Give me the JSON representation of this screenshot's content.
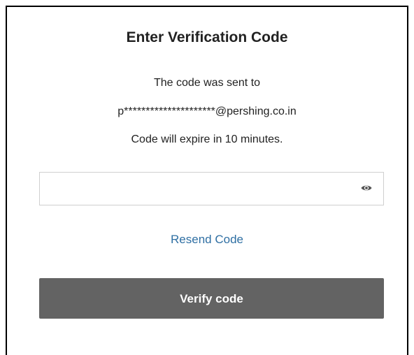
{
  "dialog": {
    "title": "Enter Verification Code",
    "sent_to_text": "The code was sent to",
    "email": "p*********************@pershing.co.in",
    "expiry_text": "Code will expire in 10 minutes."
  },
  "code_field": {
    "value": "",
    "placeholder": "",
    "toggle_icon": "eye-icon"
  },
  "resend_link": {
    "label": "Resend Code",
    "color": "#2f6fa3"
  },
  "verify_button": {
    "label": "Verify code",
    "background": "#636363"
  }
}
